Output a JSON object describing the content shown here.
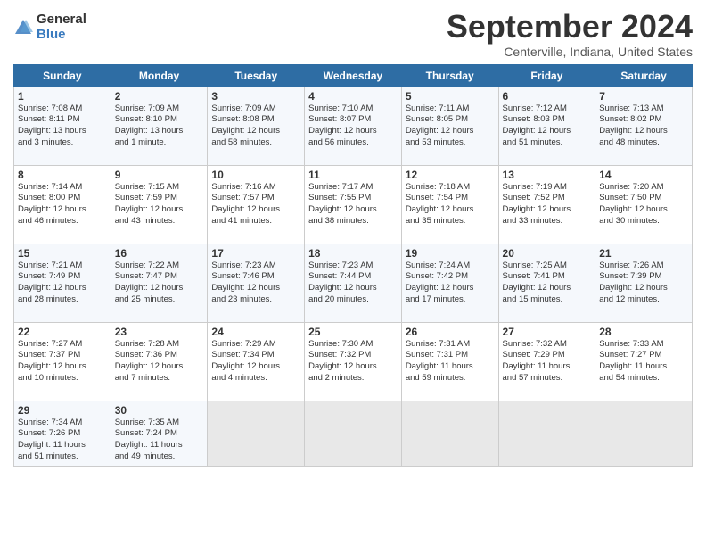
{
  "logo": {
    "general": "General",
    "blue": "Blue"
  },
  "title": "September 2024",
  "location": "Centerville, Indiana, United States",
  "days_of_week": [
    "Sunday",
    "Monday",
    "Tuesday",
    "Wednesday",
    "Thursday",
    "Friday",
    "Saturday"
  ],
  "weeks": [
    [
      {
        "day": "1",
        "info": "Sunrise: 7:08 AM\nSunset: 8:11 PM\nDaylight: 13 hours\nand 3 minutes."
      },
      {
        "day": "2",
        "info": "Sunrise: 7:09 AM\nSunset: 8:10 PM\nDaylight: 13 hours\nand 1 minute."
      },
      {
        "day": "3",
        "info": "Sunrise: 7:09 AM\nSunset: 8:08 PM\nDaylight: 12 hours\nand 58 minutes."
      },
      {
        "day": "4",
        "info": "Sunrise: 7:10 AM\nSunset: 8:07 PM\nDaylight: 12 hours\nand 56 minutes."
      },
      {
        "day": "5",
        "info": "Sunrise: 7:11 AM\nSunset: 8:05 PM\nDaylight: 12 hours\nand 53 minutes."
      },
      {
        "day": "6",
        "info": "Sunrise: 7:12 AM\nSunset: 8:03 PM\nDaylight: 12 hours\nand 51 minutes."
      },
      {
        "day": "7",
        "info": "Sunrise: 7:13 AM\nSunset: 8:02 PM\nDaylight: 12 hours\nand 48 minutes."
      }
    ],
    [
      {
        "day": "8",
        "info": "Sunrise: 7:14 AM\nSunset: 8:00 PM\nDaylight: 12 hours\nand 46 minutes."
      },
      {
        "day": "9",
        "info": "Sunrise: 7:15 AM\nSunset: 7:59 PM\nDaylight: 12 hours\nand 43 minutes."
      },
      {
        "day": "10",
        "info": "Sunrise: 7:16 AM\nSunset: 7:57 PM\nDaylight: 12 hours\nand 41 minutes."
      },
      {
        "day": "11",
        "info": "Sunrise: 7:17 AM\nSunset: 7:55 PM\nDaylight: 12 hours\nand 38 minutes."
      },
      {
        "day": "12",
        "info": "Sunrise: 7:18 AM\nSunset: 7:54 PM\nDaylight: 12 hours\nand 35 minutes."
      },
      {
        "day": "13",
        "info": "Sunrise: 7:19 AM\nSunset: 7:52 PM\nDaylight: 12 hours\nand 33 minutes."
      },
      {
        "day": "14",
        "info": "Sunrise: 7:20 AM\nSunset: 7:50 PM\nDaylight: 12 hours\nand 30 minutes."
      }
    ],
    [
      {
        "day": "15",
        "info": "Sunrise: 7:21 AM\nSunset: 7:49 PM\nDaylight: 12 hours\nand 28 minutes."
      },
      {
        "day": "16",
        "info": "Sunrise: 7:22 AM\nSunset: 7:47 PM\nDaylight: 12 hours\nand 25 minutes."
      },
      {
        "day": "17",
        "info": "Sunrise: 7:23 AM\nSunset: 7:46 PM\nDaylight: 12 hours\nand 23 minutes."
      },
      {
        "day": "18",
        "info": "Sunrise: 7:23 AM\nSunset: 7:44 PM\nDaylight: 12 hours\nand 20 minutes."
      },
      {
        "day": "19",
        "info": "Sunrise: 7:24 AM\nSunset: 7:42 PM\nDaylight: 12 hours\nand 17 minutes."
      },
      {
        "day": "20",
        "info": "Sunrise: 7:25 AM\nSunset: 7:41 PM\nDaylight: 12 hours\nand 15 minutes."
      },
      {
        "day": "21",
        "info": "Sunrise: 7:26 AM\nSunset: 7:39 PM\nDaylight: 12 hours\nand 12 minutes."
      }
    ],
    [
      {
        "day": "22",
        "info": "Sunrise: 7:27 AM\nSunset: 7:37 PM\nDaylight: 12 hours\nand 10 minutes."
      },
      {
        "day": "23",
        "info": "Sunrise: 7:28 AM\nSunset: 7:36 PM\nDaylight: 12 hours\nand 7 minutes."
      },
      {
        "day": "24",
        "info": "Sunrise: 7:29 AM\nSunset: 7:34 PM\nDaylight: 12 hours\nand 4 minutes."
      },
      {
        "day": "25",
        "info": "Sunrise: 7:30 AM\nSunset: 7:32 PM\nDaylight: 12 hours\nand 2 minutes."
      },
      {
        "day": "26",
        "info": "Sunrise: 7:31 AM\nSunset: 7:31 PM\nDaylight: 11 hours\nand 59 minutes."
      },
      {
        "day": "27",
        "info": "Sunrise: 7:32 AM\nSunset: 7:29 PM\nDaylight: 11 hours\nand 57 minutes."
      },
      {
        "day": "28",
        "info": "Sunrise: 7:33 AM\nSunset: 7:27 PM\nDaylight: 11 hours\nand 54 minutes."
      }
    ],
    [
      {
        "day": "29",
        "info": "Sunrise: 7:34 AM\nSunset: 7:26 PM\nDaylight: 11 hours\nand 51 minutes."
      },
      {
        "day": "30",
        "info": "Sunrise: 7:35 AM\nSunset: 7:24 PM\nDaylight: 11 hours\nand 49 minutes."
      },
      {
        "day": "",
        "info": ""
      },
      {
        "day": "",
        "info": ""
      },
      {
        "day": "",
        "info": ""
      },
      {
        "day": "",
        "info": ""
      },
      {
        "day": "",
        "info": ""
      }
    ]
  ]
}
